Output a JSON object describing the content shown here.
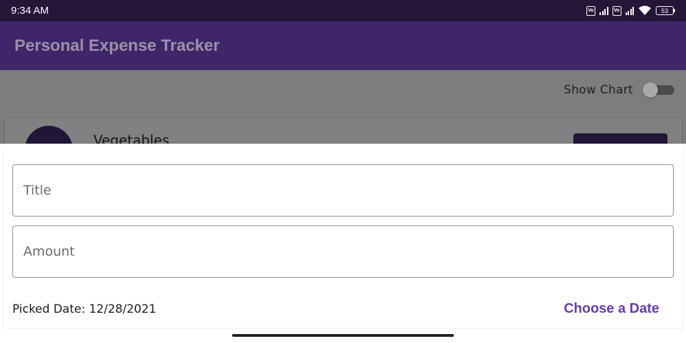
{
  "status_bar": {
    "time": "9:34 AM",
    "volte_label": "Vo LTE",
    "battery": "53"
  },
  "app_bar": {
    "title": "Personal Expense Tracker"
  },
  "background": {
    "show_chart_label": "Show Chart",
    "show_chart_on": false,
    "first_item_title": "Vegetables"
  },
  "sheet": {
    "title_placeholder": "Title",
    "title_value": "",
    "amount_placeholder": "Amount",
    "amount_value": "",
    "picked_date_text": "Picked Date: 12/28/2021",
    "choose_date_label": "Choose a Date"
  },
  "colors": {
    "primary": "#40256b",
    "accent": "#673ab7",
    "status_bar": "#251537"
  }
}
